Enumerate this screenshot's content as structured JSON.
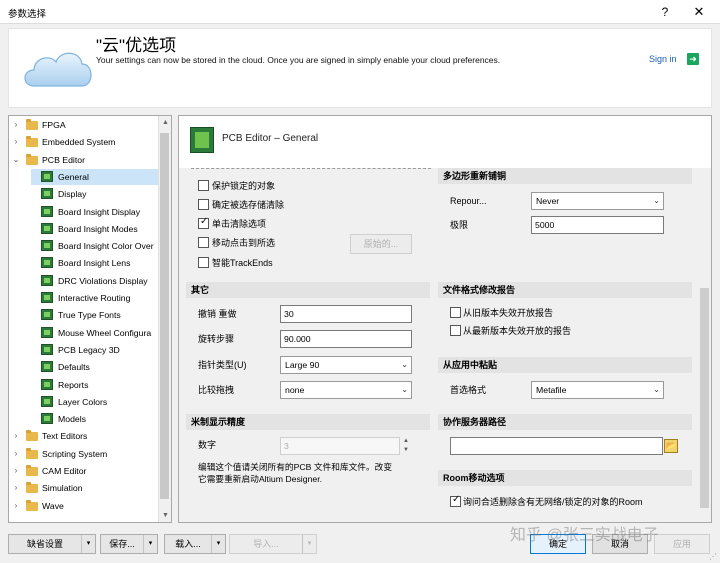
{
  "window": {
    "title": "参数选择",
    "help": "?",
    "close": "✕"
  },
  "banner": {
    "title": "\"云\"优选项",
    "desc": "Your settings can now be stored in the cloud. Once you are signed in simply enable your cloud preferences.",
    "signin": "Sign in",
    "signin_arrow": "➜"
  },
  "tree": {
    "items": [
      {
        "label": "FPGA",
        "kind": "folder",
        "level": 0,
        "expander": "›"
      },
      {
        "label": "Embedded System",
        "kind": "folder",
        "level": 0,
        "expander": "›"
      },
      {
        "label": "PCB Editor",
        "kind": "folder",
        "level": 0,
        "expander": "⌄"
      },
      {
        "label": "General",
        "kind": "leaf",
        "level": 1,
        "selected": true
      },
      {
        "label": "Display",
        "kind": "leaf",
        "level": 1
      },
      {
        "label": "Board Insight Display",
        "kind": "leaf",
        "level": 1
      },
      {
        "label": "Board Insight Modes",
        "kind": "leaf",
        "level": 1
      },
      {
        "label": "Board Insight Color Over",
        "kind": "leaf",
        "level": 1
      },
      {
        "label": "Board Insight Lens",
        "kind": "leaf",
        "level": 1
      },
      {
        "label": "DRC Violations Display",
        "kind": "leaf",
        "level": 1
      },
      {
        "label": "Interactive Routing",
        "kind": "leaf",
        "level": 1
      },
      {
        "label": "True Type Fonts",
        "kind": "leaf",
        "level": 1
      },
      {
        "label": "Mouse Wheel Configura",
        "kind": "leaf",
        "level": 1
      },
      {
        "label": "PCB Legacy 3D",
        "kind": "leaf",
        "level": 1
      },
      {
        "label": "Defaults",
        "kind": "leaf",
        "level": 1
      },
      {
        "label": "Reports",
        "kind": "leaf",
        "level": 1
      },
      {
        "label": "Layer Colors",
        "kind": "leaf",
        "level": 1
      },
      {
        "label": "Models",
        "kind": "leaf",
        "level": 1
      },
      {
        "label": "Text Editors",
        "kind": "folder",
        "level": 0,
        "expander": "›"
      },
      {
        "label": "Scripting System",
        "kind": "folder",
        "level": 0,
        "expander": "›"
      },
      {
        "label": "CAM Editor",
        "kind": "folder",
        "level": 0,
        "expander": "›"
      },
      {
        "label": "Simulation",
        "kind": "folder",
        "level": 0,
        "expander": "›"
      },
      {
        "label": "Wave",
        "kind": "folder",
        "level": 0,
        "expander": "›"
      }
    ],
    "scroll_up": "▲",
    "scroll_down": "▼"
  },
  "panel": {
    "title": "PCB Editor – General",
    "left": {
      "checks": [
        {
          "label": "保护锁定的对象",
          "checked": false
        },
        {
          "label": "确定被选存储清除",
          "checked": false
        },
        {
          "label": "单击清除选项",
          "checked": true
        },
        {
          "label": "移动点击到所选",
          "checked": false
        },
        {
          "label": "智能TrackEnds",
          "checked": false
        }
      ],
      "origin_button": "原始的...",
      "other_section": "其它",
      "undo_label": "撤销 重做",
      "undo_value": "30",
      "rotate_label": "旋转步骤",
      "rotate_value": "90.000",
      "cursor_label": "指针类型(U)",
      "cursor_value": "Large 90",
      "drag_label": "比较拖拽",
      "drag_value": "none",
      "metric_section": "米制显示精度",
      "digits_label": "数字",
      "digits_value": "3",
      "note": "编辑这个值请关闭所有的PCB 文件和库文件。改变它需要重新启动Altium Designer."
    },
    "right": {
      "repour_section": "多边形重新铺铜",
      "repour_label": "Repour...",
      "repour_value": "Never",
      "limit_label": "极限",
      "limit_value": "5000",
      "filefmt_section": "文件格式修改报告",
      "filefmt_checks": [
        {
          "label": "从旧版本失效开放报告",
          "checked": false
        },
        {
          "label": "从最新版本失效开放的报告",
          "checked": false
        }
      ],
      "paste_section": "从应用中粘贴",
      "paste_label": "首选格式",
      "paste_value": "Metafile",
      "server_section": "协作服务器路径",
      "server_value": "",
      "room_section": "Room移动选项",
      "room_check": {
        "label": "询问合适删除含有无网络/锁定的对象的Room",
        "checked": true
      }
    },
    "dropdown_glyph": "⌄",
    "spin_up": "▲",
    "spin_down": "▼",
    "browse_glyph": "📂"
  },
  "footer": {
    "defaults": "缺省设置",
    "save": "保存...",
    "load": "载入...",
    "import": "导入...",
    "ok": "确定",
    "cancel": "取消",
    "apply": "应用",
    "menu_arrow": "▾",
    "watermark": "知乎 @张三实战电子",
    "grip": "⋰"
  }
}
